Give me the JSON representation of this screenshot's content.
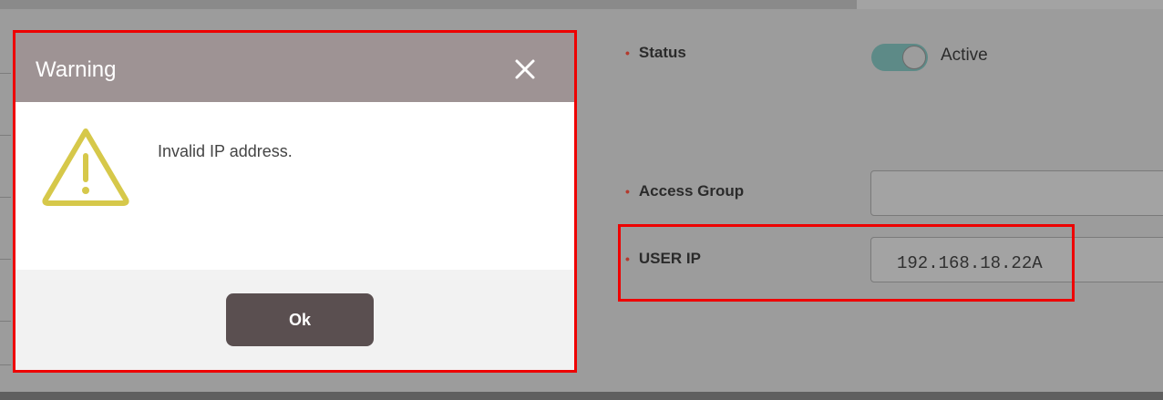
{
  "form": {
    "status": {
      "label": "Status",
      "toggle_value": "Active"
    },
    "access_group": {
      "label": "Access Group",
      "value": ""
    },
    "user_ip": {
      "label": "USER IP",
      "value": "192.168.18.22A"
    }
  },
  "dialog": {
    "title": "Warning",
    "message": "Invalid IP address.",
    "ok_label": "Ok",
    "icon": "warning-triangle-icon",
    "close_icon": "close-icon"
  },
  "colors": {
    "header_bg": "#9e9394",
    "warning_icon": "#d6c84a",
    "ok_button_bg": "#5a4f50",
    "toggle_on": "#5d8a87",
    "highlight": "#ee0000"
  }
}
